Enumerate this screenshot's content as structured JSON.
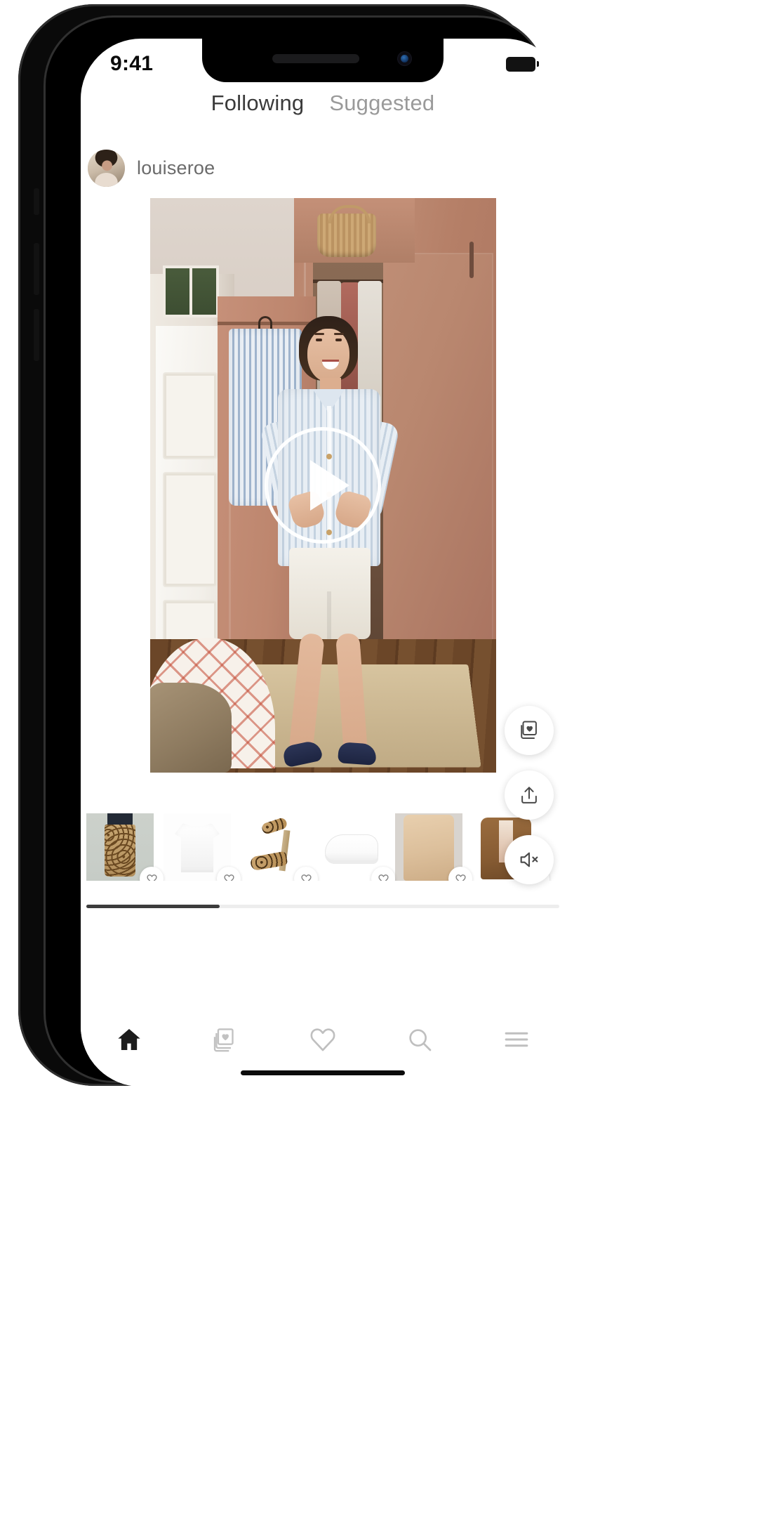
{
  "status_bar": {
    "time": "9:41",
    "battery_icon": "battery-full-icon",
    "speaker_icon": "speaker-grille-icon",
    "camera_icon": "front-camera-icon"
  },
  "tabs": [
    {
      "label": "Following",
      "active": true
    },
    {
      "label": "Suggested",
      "active": false
    }
  ],
  "post": {
    "username": "louiseroe",
    "avatar_icon": "user-avatar",
    "media_type": "video",
    "play_button_icon": "play-icon"
  },
  "video_actions": [
    {
      "name": "save-to-collection-button",
      "icon": "collection-heart-icon"
    },
    {
      "name": "share-button",
      "icon": "share-upload-icon"
    },
    {
      "name": "mute-button",
      "icon": "speaker-mute-icon"
    }
  ],
  "products": [
    {
      "name": "leopard-print-midi-skirt",
      "art": "pr-skirt",
      "fav_icon": "heart-outline-icon"
    },
    {
      "name": "white-t-shirt",
      "art": "pr-tee",
      "fav_icon": "heart-outline-icon"
    },
    {
      "name": "leopard-heeled-sandal",
      "art": "pr-heel",
      "fav_icon": "heart-outline-icon"
    },
    {
      "name": "white-sneaker",
      "art": "pr-sneaker",
      "fav_icon": "heart-outline-icon"
    },
    {
      "name": "beige-knit-cardigan",
      "art": "pr-cardigan",
      "fav_icon": "heart-outline-icon"
    },
    {
      "name": "brown-double-breasted-blazer",
      "art": "pr-blazer",
      "fav_icon": "heart-outline-icon"
    }
  ],
  "scroll": {
    "progress_percent": 28
  },
  "bottom_nav": [
    {
      "name": "nav-home",
      "icon": "home-icon",
      "active": true
    },
    {
      "name": "nav-collections",
      "icon": "collection-heart-icon",
      "active": false
    },
    {
      "name": "nav-likes",
      "icon": "heart-outline-icon",
      "active": false
    },
    {
      "name": "nav-search",
      "icon": "search-icon",
      "active": false
    },
    {
      "name": "nav-menu",
      "icon": "hamburger-menu-icon",
      "active": false
    }
  ],
  "colors": {
    "active_tab": "#3a3a3a",
    "inactive_tab": "#9a9a9a",
    "username": "#6b6b6b",
    "nav_active": "#1c1c1c",
    "nav_inactive": "#bdbdbd",
    "scroll_thumb": "#3c3c3c"
  }
}
